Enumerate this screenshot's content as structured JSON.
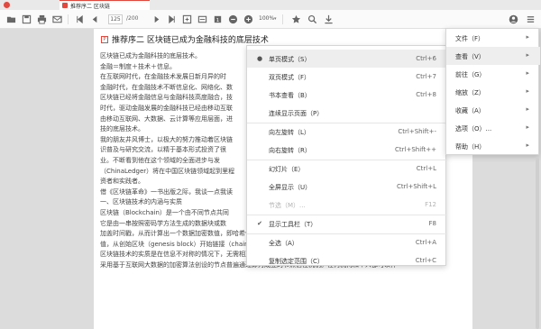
{
  "tab": {
    "title": "推荐序二 区块链"
  },
  "toolbar": {
    "page_current": "125",
    "page_total": "/200",
    "zoom": "100%"
  },
  "document": {
    "title": "推荐序二 区块链已成为金融科技的底层技术",
    "lines": [
      "区块链已成为金融科技的底层技术。",
      "金融＝制度＋技术＋信息。",
      "在互联网时代，在金融技术发展日新月异的时",
      "金融时代，在金融技术不断信息化、网络化、数",
      "区块链已经将金融信息与金融科技高度融合，技",
      "时代，驱动金融发展的金融科技已经由移动互联",
      "由移动互联网、大数据、云计算等应用层面，进",
      "技的底层技术。",
      "我的朋友井风博士，以极大的努力推动着区块链",
      "识普及与研究交流，以精于基本形式投资了很",
      "业。不断看到他在这个领域的全面进步与发",
      "（ChinaLedger）将在中国区块链领域起到里程",
      "资者和实践者。",
      "借《区块链革命》一书出版之际，我谈一点我读",
      "一、区块链技术的内涵与实质",
      "区块链（Blockchain）是一个由不同节点共同",
      "它是由一串按照密码学方法生成的数据块或数",
      "加盖时间戳，从而计算出一个数据加密数值，即哈希值（hash）。每一个区块都包含上一个区块的哈希",
      "值，从创始区块（genesis block）开始链接（chain）到当前区块，从而形成区块链。",
      "区块链技术的实质是在信息不对称的情况下，无需相互担保信任或第三方（所谓的“中心”）核发信用证书，",
      "采用基于互联网大数据的加密算法创设的节点普遍通过即为成立的节点信任机制。任何机构和个人都可以作"
    ]
  },
  "context_menu": {
    "items": [
      {
        "mark": "●",
        "label": "单页模式（S）",
        "shortcut": "Ctrl+6",
        "disabled": false,
        "highlight": true
      },
      {
        "mark": "",
        "label": "双页模式（F）",
        "shortcut": "Ctrl+7",
        "disabled": false,
        "highlight": false
      },
      {
        "mark": "",
        "label": "书本查看（B）",
        "shortcut": "Ctrl+8",
        "disabled": false,
        "highlight": false
      },
      {
        "mark": "",
        "label": "连续显示页面（P）",
        "shortcut": "",
        "disabled": false,
        "highlight": false
      },
      {
        "mark": "",
        "label": "向左旋转（L）",
        "shortcut": "Ctrl+Shift+-",
        "disabled": false,
        "highlight": false
      },
      {
        "mark": "",
        "label": "向右旋转（R）",
        "shortcut": "Ctrl+Shift++",
        "disabled": false,
        "highlight": false
      },
      {
        "mark": "",
        "label": "幻灯片（E）",
        "shortcut": "Ctrl+L",
        "disabled": false,
        "highlight": false
      },
      {
        "mark": "",
        "label": "全屏显示（U）",
        "shortcut": "Ctrl+Shift+L",
        "disabled": false,
        "highlight": false
      },
      {
        "mark": "",
        "label": "节选（M）...",
        "shortcut": "F12",
        "disabled": true,
        "highlight": false
      },
      {
        "mark": "✔",
        "label": "显示工具栏（T）",
        "shortcut": "F8",
        "disabled": false,
        "highlight": false
      },
      {
        "mark": "",
        "label": "全选（A）",
        "shortcut": "Ctrl+A",
        "disabled": false,
        "highlight": false
      },
      {
        "mark": "",
        "label": "复制选定范围（C）",
        "shortcut": "Ctrl+C",
        "disabled": false,
        "highlight": false
      }
    ]
  },
  "main_menu": {
    "items": [
      {
        "label": "文件（F）",
        "highlight": false
      },
      {
        "label": "查看（V）",
        "highlight": true
      },
      {
        "label": "前往（G）",
        "highlight": false
      },
      {
        "label": "缩放（Z）",
        "highlight": false
      },
      {
        "label": "收藏（A）",
        "highlight": false
      },
      {
        "label": "选项（O）...",
        "highlight": false
      },
      {
        "label": "帮助（H）",
        "highlight": false
      }
    ],
    "arrow": "▸"
  },
  "colors": {
    "accent": "#e2483d",
    "menu_highlight": "#eeeeee"
  }
}
